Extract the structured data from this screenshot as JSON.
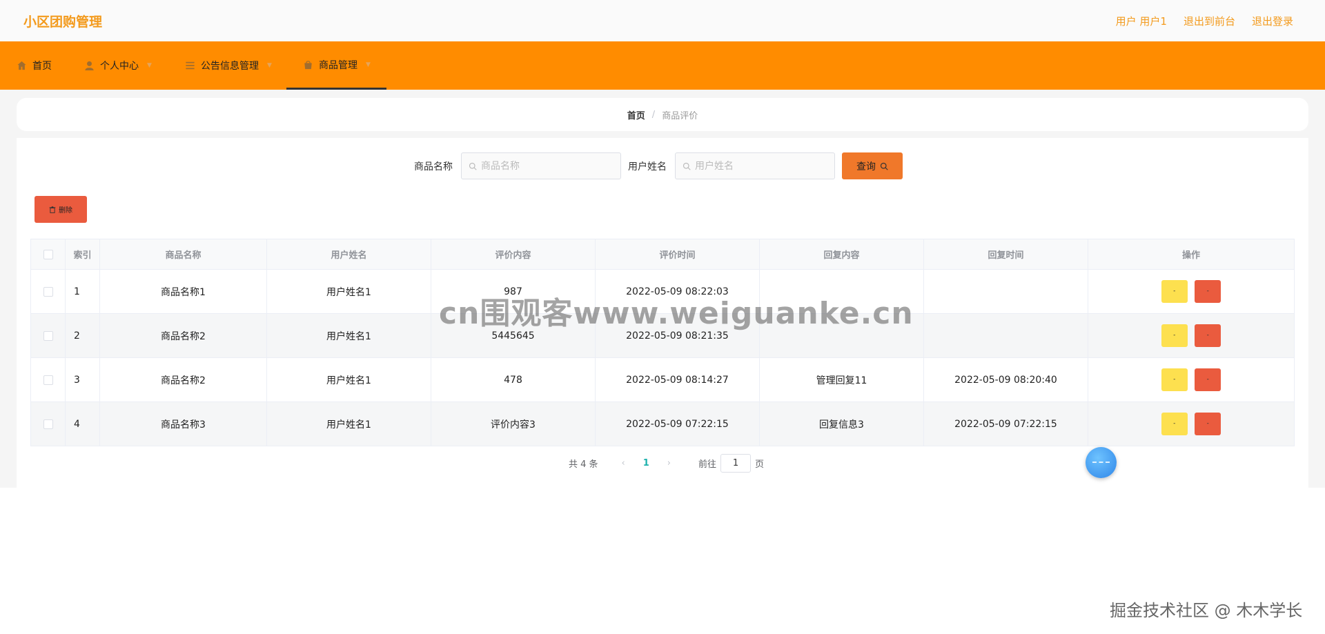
{
  "app": {
    "title": "小区团购管理",
    "top_links": [
      "用户 用户1",
      "退出到前台",
      "退出登录"
    ]
  },
  "nav": {
    "items": [
      {
        "label": "首页",
        "icon": "home-icon"
      },
      {
        "label": "个人中心",
        "icon": "user-icon"
      },
      {
        "label": "公告信息管理",
        "icon": "list-icon"
      },
      {
        "label": "商品管理",
        "icon": "goods-icon"
      }
    ],
    "active_index": 3
  },
  "breadcrumb": {
    "home": "首页",
    "separator": "/",
    "current": "商品评价"
  },
  "search": {
    "field1_label": "商品名称",
    "field1_placeholder": "商品名称",
    "field2_label": "用户姓名",
    "field2_placeholder": "用户姓名",
    "query_label": "查询"
  },
  "delete_button_label": "删除",
  "table": {
    "columns": [
      "索引",
      "商品名称",
      "用户姓名",
      "评价内容",
      "评价时间",
      "回复内容",
      "回复时间",
      "操作"
    ],
    "rows": [
      {
        "index": "1",
        "goods": "商品名称1",
        "user": "用户姓名1",
        "content": "987",
        "time": "2022-05-09 08:22:03",
        "reply": "",
        "reply_time": ""
      },
      {
        "index": "2",
        "goods": "商品名称2",
        "user": "用户姓名1",
        "content": "5445645",
        "time": "2022-05-09 08:21:35",
        "reply": "",
        "reply_time": ""
      },
      {
        "index": "3",
        "goods": "商品名称2",
        "user": "用户姓名1",
        "content": "478",
        "time": "2022-05-09 08:14:27",
        "reply": "管理回复11",
        "reply_time": "2022-05-09 08:20:40"
      },
      {
        "index": "4",
        "goods": "商品名称3",
        "user": "用户姓名1",
        "content": "评价内容3",
        "time": "2022-05-09 07:22:15",
        "reply": "回复信息3",
        "reply_time": "2022-05-09 07:22:15"
      }
    ],
    "op_edit_label": "-",
    "op_del_label": "-"
  },
  "pager": {
    "total": "共 4 条",
    "prev": "‹",
    "current_page": "1",
    "next": "›",
    "goto_prefix": "前往",
    "goto_value": "1",
    "goto_suffix": "页"
  },
  "watermarks": {
    "center": "cn围观客www.weiguanke.cn",
    "corner": "掘金技术社区 @ 木木学长"
  },
  "colors": {
    "accent": "#ff8c00",
    "title": "#f39a1c",
    "query_button": "#f0782a",
    "delete_button": "#ea5b3e",
    "edit_button": "#fde04f",
    "page_active": "#1cb1ac"
  }
}
